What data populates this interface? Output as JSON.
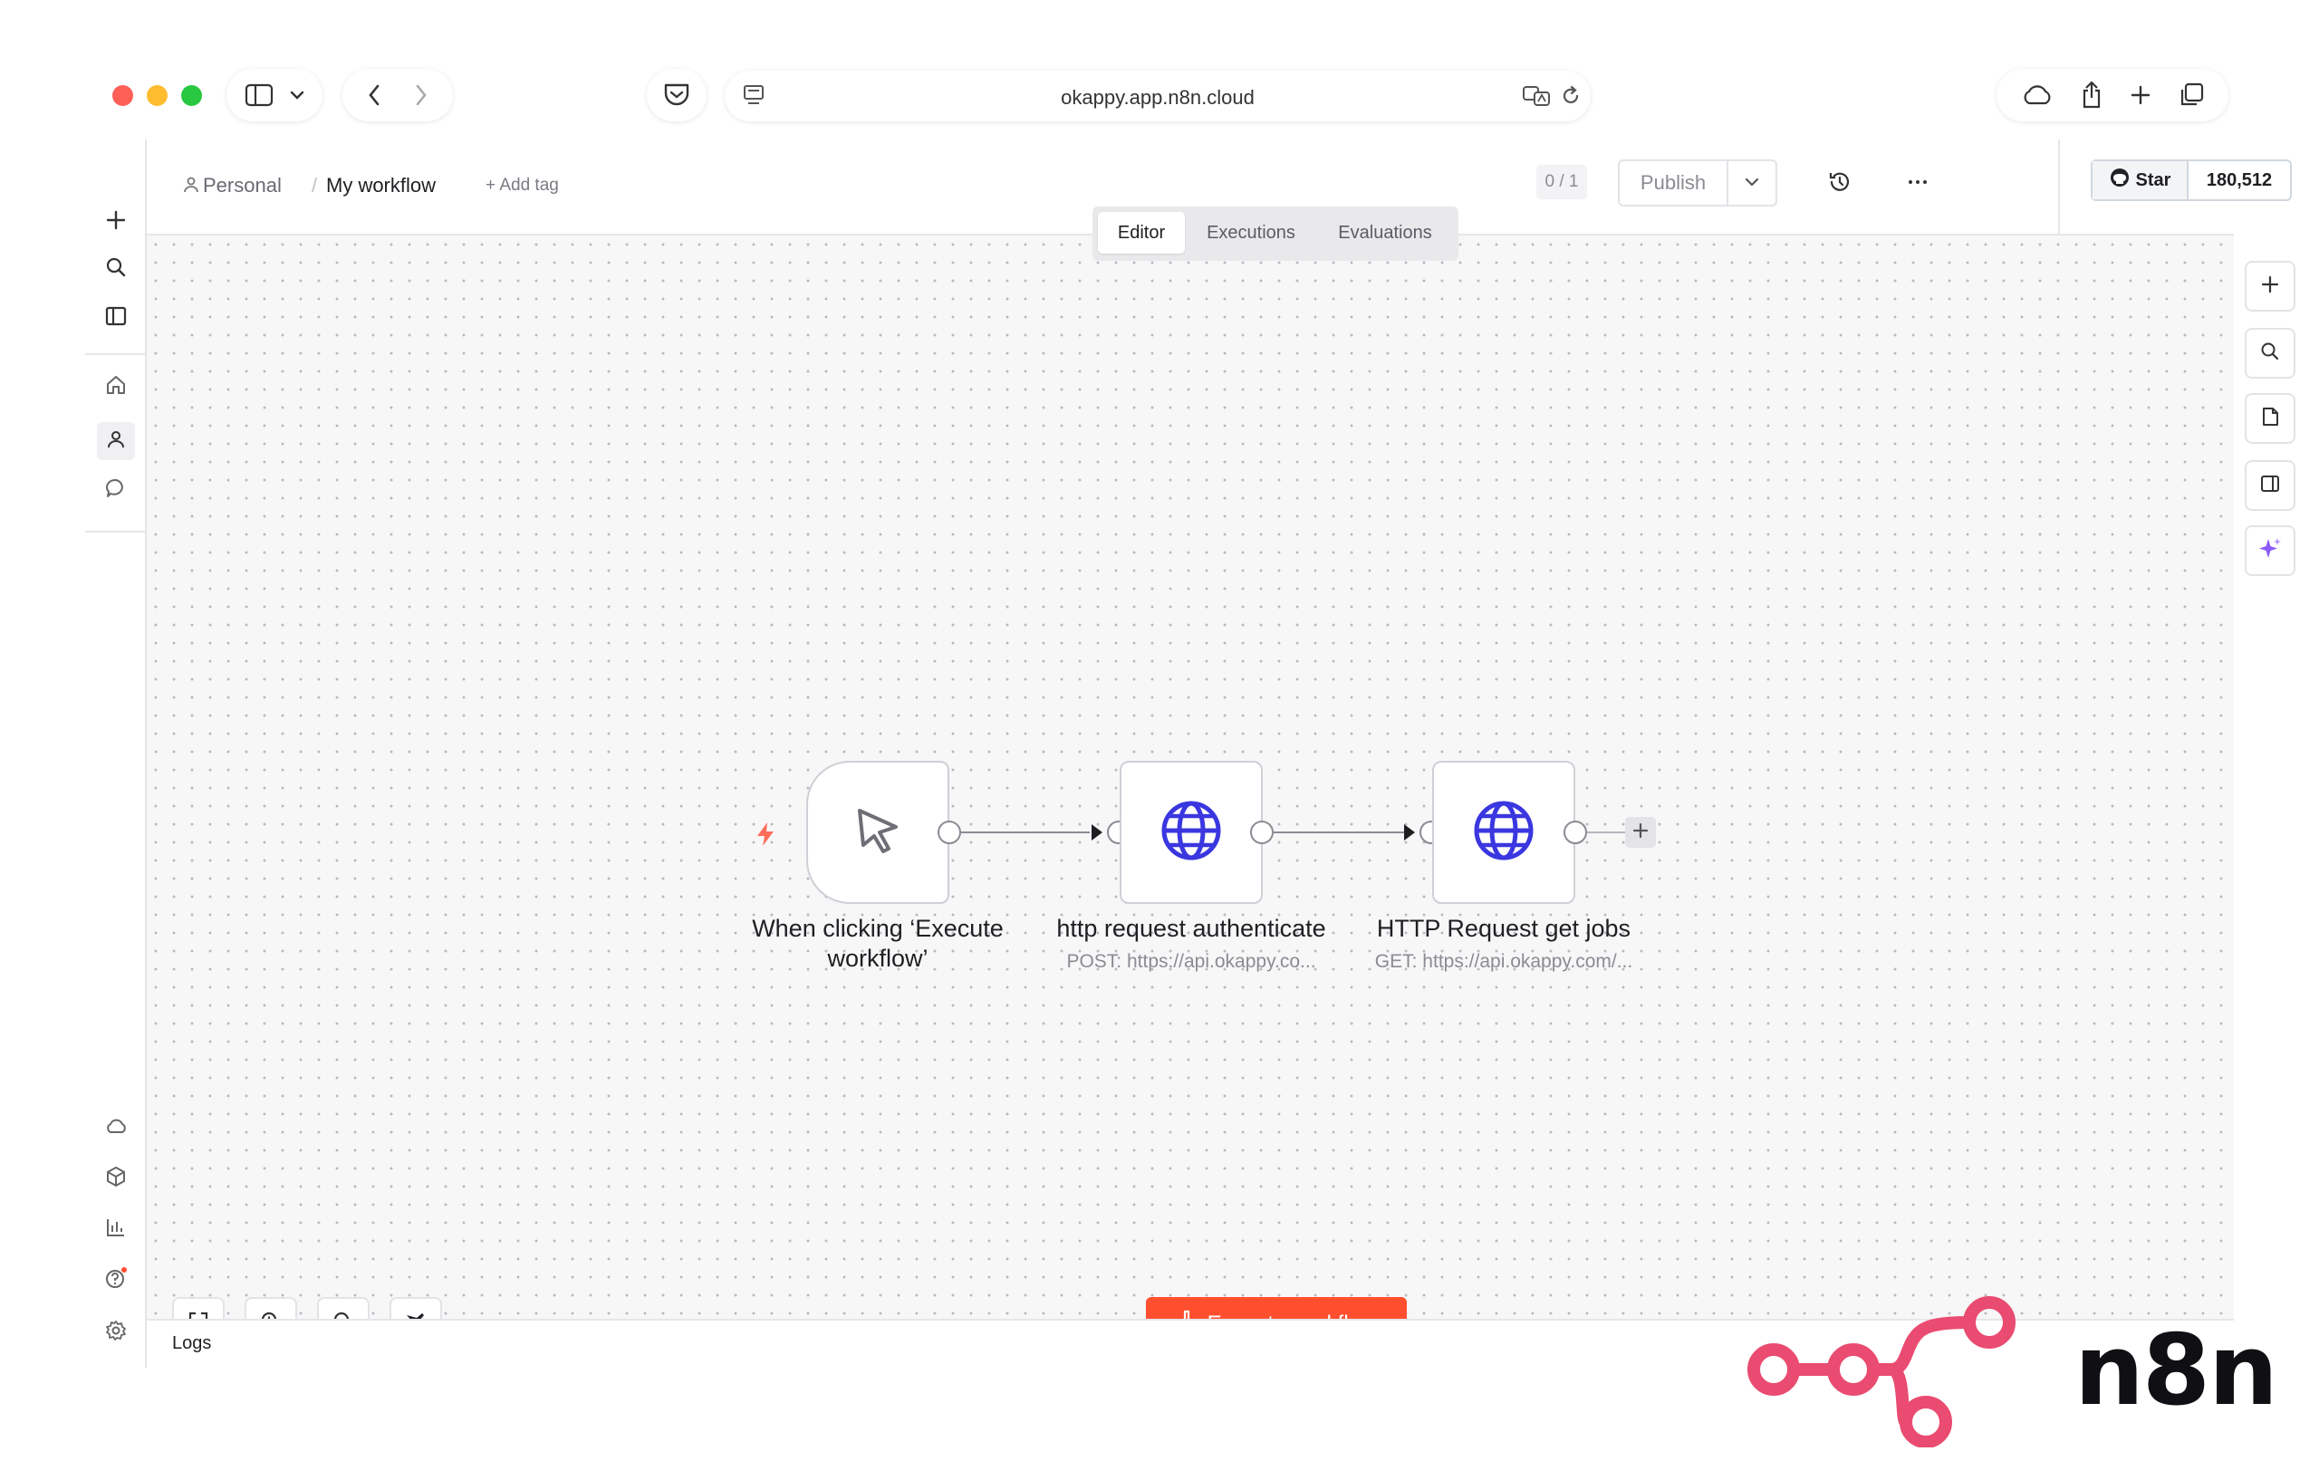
{
  "browser": {
    "url": "okappy.app.n8n.cloud",
    "traffic_colors": {
      "close": "#fe5f57",
      "minimize": "#febc2e",
      "maximize": "#28c840"
    }
  },
  "header": {
    "breadcrumb_home": "Personal",
    "breadcrumb_separator": "/",
    "workflow_name": "My workflow",
    "add_tag": "+ Add tag",
    "counter": "0 / 1",
    "publish_label": "Publish",
    "star_label": "Star",
    "star_count": "180,512"
  },
  "tabs": [
    {
      "label": "Editor",
      "active": true
    },
    {
      "label": "Executions",
      "active": false
    },
    {
      "label": "Evaluations",
      "active": false
    }
  ],
  "nodes": [
    {
      "title": "When clicking ‘Execute workflow’",
      "subtitle": "",
      "icon": "cursor-icon"
    },
    {
      "title": "http request authenticate",
      "subtitle": "POST: https://api.okappy.co...",
      "icon": "globe-icon"
    },
    {
      "title": "HTTP Request get jobs",
      "subtitle": "GET: https://api.okappy.com/...",
      "icon": "globe-icon"
    }
  ],
  "execute_button": "Execute workflow",
  "logs_label": "Logs",
  "logo_text": "n8n",
  "colors": {
    "accent": "#ff4f2e",
    "globe": "#3a37e0",
    "logo": "#ea4b71",
    "ai": "#8d5cf6"
  }
}
